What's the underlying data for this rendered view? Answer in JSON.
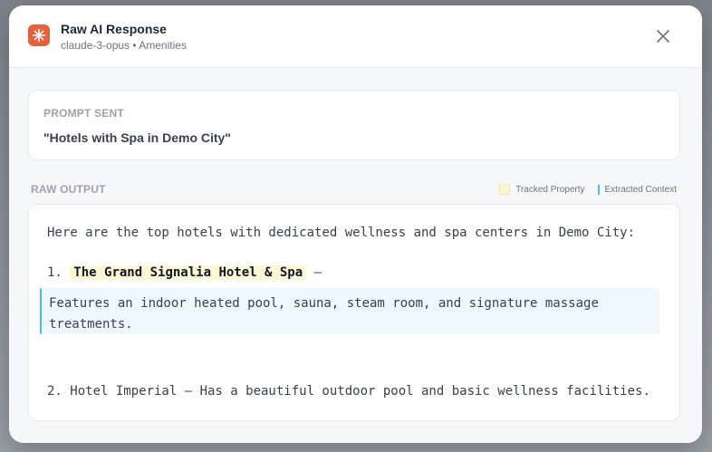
{
  "header": {
    "title": "Raw AI Response",
    "subtitle": "claude-3-opus • Amenities"
  },
  "prompt": {
    "label": "PROMPT SENT",
    "text": "\"Hotels with Spa in Demo City\""
  },
  "raw_output": {
    "label": "RAW OUTPUT",
    "legend": {
      "tracked": "Tracked Property",
      "context": "Extracted Context"
    },
    "intro": "Here are the top hotels with dedicated wellness and spa centers in Demo City:",
    "items": [
      {
        "number": "1.",
        "name": "The Grand Signalia Hotel & Spa",
        "dash": "–",
        "context": "Features an indoor heated pool, sauna, steam room, and signature massage treatments."
      },
      {
        "text": "2. Hotel Imperial – Has a beautiful outdoor pool and basic wellness facilities."
      }
    ]
  },
  "colors": {
    "accent": "#e5603b",
    "tracked_highlight": "#fdf6d3",
    "context_border": "#4fb8e8",
    "context_bg": "#eef7fd"
  },
  "icons": {
    "app": "sparkle-icon",
    "close": "close-icon"
  }
}
